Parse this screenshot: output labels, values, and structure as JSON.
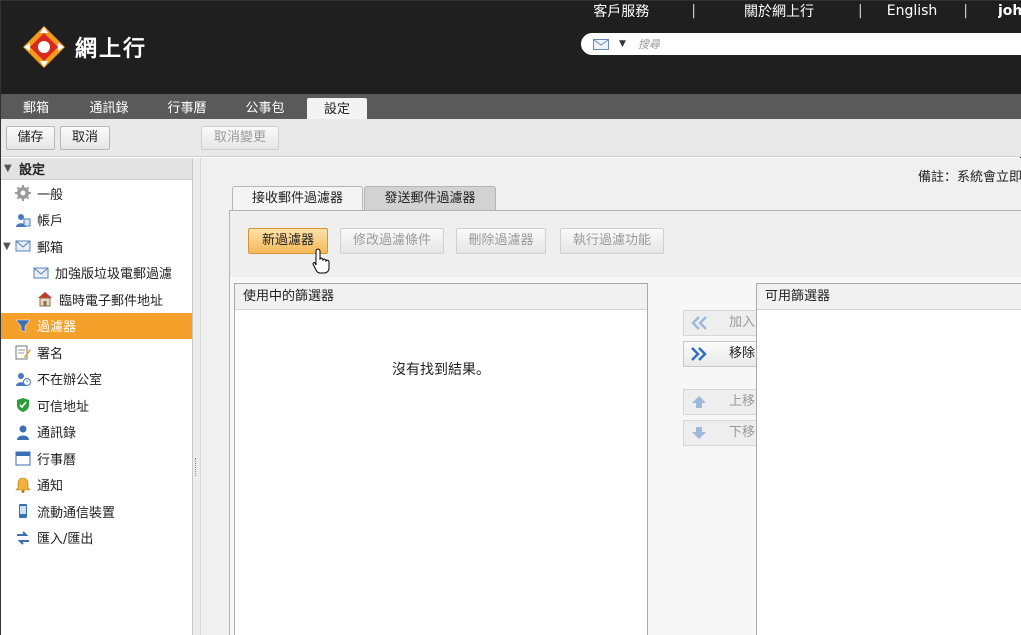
{
  "header": {
    "links": [
      "客戶服務",
      "關於網上行",
      "English",
      "john"
    ],
    "logo_text": "網上行",
    "search_placeholder": "搜尋"
  },
  "tabs": [
    "郵箱",
    "通訊錄",
    "行事曆",
    "公事包",
    "設定"
  ],
  "active_tab": "設定",
  "toolbar": {
    "save": "儲存",
    "cancel": "取消",
    "revert": "取消變更"
  },
  "sidebar": {
    "title": "設定",
    "items": [
      {
        "label": "一般",
        "icon": "gear-icon"
      },
      {
        "label": "帳戶",
        "icon": "account-icon"
      },
      {
        "label": "郵箱",
        "icon": "mail-icon"
      },
      {
        "label": "加強版垃圾電郵過濾",
        "icon": "mail-icon"
      },
      {
        "label": "臨時電子郵件地址",
        "icon": "house-icon"
      },
      {
        "label": "過濾器",
        "icon": "filter-icon"
      },
      {
        "label": "署名",
        "icon": "signature-icon"
      },
      {
        "label": "不在辦公室",
        "icon": "out-of-office-icon"
      },
      {
        "label": "可信地址",
        "icon": "shield-check-icon"
      },
      {
        "label": "通訊錄",
        "icon": "contact-icon"
      },
      {
        "label": "行事曆",
        "icon": "calendar-icon"
      },
      {
        "label": "通知",
        "icon": "bell-icon"
      },
      {
        "label": "流動通信裝置",
        "icon": "mobile-icon"
      },
      {
        "label": "匯入/匯出",
        "icon": "import-export-icon"
      }
    ]
  },
  "main": {
    "note": "備註：系統會立即",
    "filter_tabs": [
      "接收郵件過濾器",
      "發送郵件過濾器"
    ],
    "actions": {
      "new": "新過濾器",
      "edit": "修改過濾條件",
      "delete": "刪除過濾器",
      "run": "執行過濾功能"
    },
    "active_box_title": "使用中的篩選器",
    "available_box_title": "可用篩選器",
    "empty_text": "沒有找到結果。",
    "move": {
      "add": "加入",
      "remove": "移除",
      "up": "上移",
      "down": "下移"
    }
  },
  "colors": {
    "header_bg": "#1f1f1f",
    "accent_orange": "#f6a02c",
    "tabbar_bg": "#5a5a5a"
  }
}
